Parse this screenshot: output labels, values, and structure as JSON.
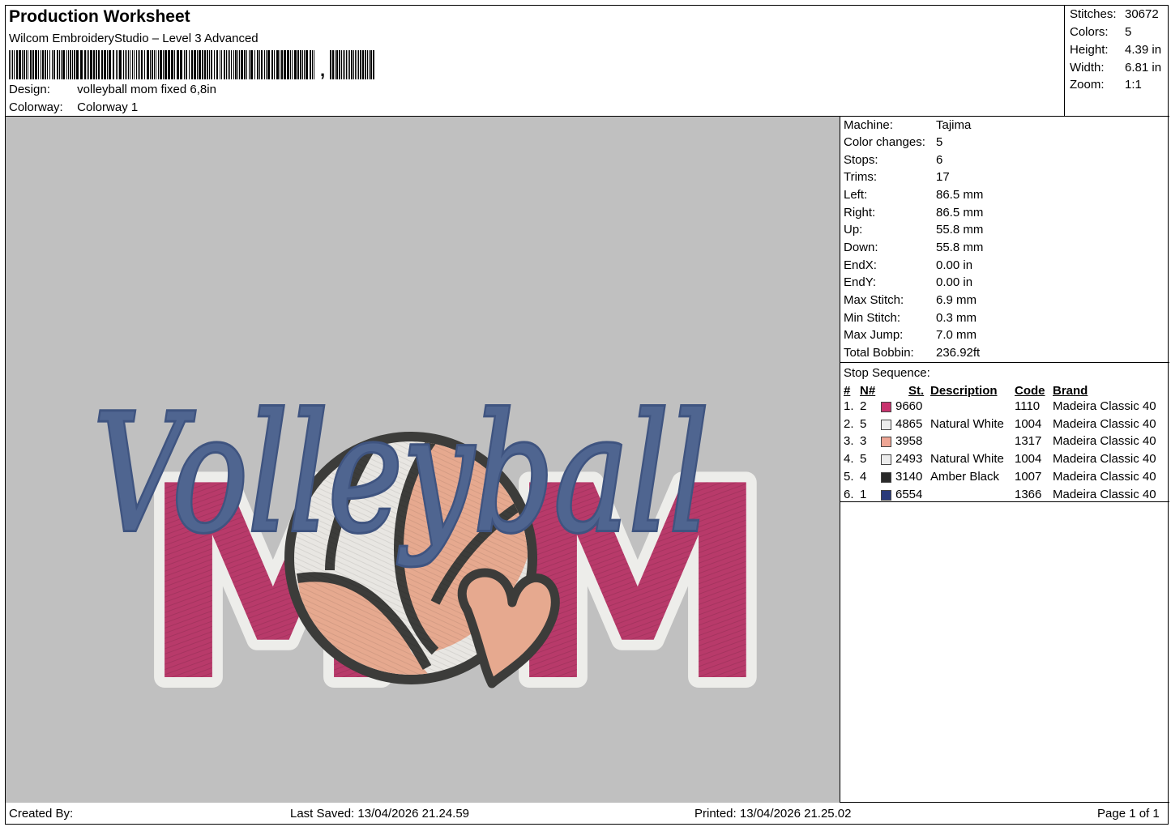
{
  "header": {
    "title": "Production Worksheet",
    "subtitle": "Wilcom EmbroideryStudio – Level 3 Advanced",
    "barcode_suffix": ",",
    "design_label": "Design:",
    "design_value": "volleyball mom fixed 6,8in",
    "colorway_label": "Colorway:",
    "colorway_value": "Colorway 1"
  },
  "stats": [
    {
      "label": "Stitches:",
      "value": "30672"
    },
    {
      "label": "Colors:",
      "value": "5"
    },
    {
      "label": "Height:",
      "value": "4.39 in"
    },
    {
      "label": "Width:",
      "value": "6.81 in"
    },
    {
      "label": "Zoom:",
      "value": "1:1"
    }
  ],
  "machine": [
    {
      "label": "Machine:",
      "value": "Tajima"
    },
    {
      "label": "Color changes:",
      "value": "5"
    },
    {
      "label": "Stops:",
      "value": "6"
    },
    {
      "label": "Trims:",
      "value": "17"
    },
    {
      "label": "Left:",
      "value": "86.5 mm"
    },
    {
      "label": "Right:",
      "value": "86.5 mm"
    },
    {
      "label": "Up:",
      "value": "55.8 mm"
    },
    {
      "label": "Down:",
      "value": "55.8 mm"
    },
    {
      "label": "EndX:",
      "value": "0.00 in"
    },
    {
      "label": "EndY:",
      "value": "0.00 in"
    },
    {
      "label": "Max Stitch:",
      "value": "6.9 mm"
    },
    {
      "label": "Min Stitch:",
      "value": "0.3 mm"
    },
    {
      "label": "Max Jump:",
      "value": "7.0 mm"
    },
    {
      "label": "Total Bobbin:",
      "value": "236.92ft"
    }
  ],
  "stop_sequence": {
    "title": "Stop Sequence:",
    "columns": {
      "num": "#",
      "n": "N#",
      "st": "St.",
      "description": "Description",
      "code": "Code",
      "brand": "Brand"
    },
    "rows": [
      {
        "num": "1.",
        "n": "2",
        "color": "#c8336e",
        "st": "9660",
        "description": "",
        "code": "1110",
        "brand": "Madeira Classic 40"
      },
      {
        "num": "2.",
        "n": "5",
        "color": "#ececec",
        "st": "4865",
        "description": "Natural White",
        "code": "1004",
        "brand": "Madeira Classic 40"
      },
      {
        "num": "3.",
        "n": "3",
        "color": "#eea594",
        "st": "3958",
        "description": "",
        "code": "1317",
        "brand": "Madeira Classic 40"
      },
      {
        "num": "4.",
        "n": "5",
        "color": "#ececec",
        "st": "2493",
        "description": "Natural White",
        "code": "1004",
        "brand": "Madeira Classic 40"
      },
      {
        "num": "5.",
        "n": "4",
        "color": "#2a2a2a",
        "st": "3140",
        "description": "Amber Black",
        "code": "1007",
        "brand": "Madeira Classic 40"
      },
      {
        "num": "6.",
        "n": "1",
        "color": "#2a3a7a",
        "st": "6554",
        "description": "",
        "code": "1366",
        "brand": "Madeira Classic 40"
      }
    ]
  },
  "design_image": {
    "script_text": "Volleyball",
    "block_text_left": "M",
    "block_text_right": "M",
    "colors": {
      "background": "#c0c0c0",
      "script": "#4f6590",
      "block_fill": "#b83a6a",
      "block_outline": "#ededea",
      "ball_outline": "#3c3c3a",
      "ball_peach": "#e6a98f",
      "ball_white": "#e8e6e2"
    }
  },
  "footer": {
    "created_by": "Created By:",
    "last_saved": "Last Saved: 13/04/2026 21.24.59",
    "printed": "Printed: 13/04/2026 21.25.02",
    "page": "Page 1 of 1"
  }
}
